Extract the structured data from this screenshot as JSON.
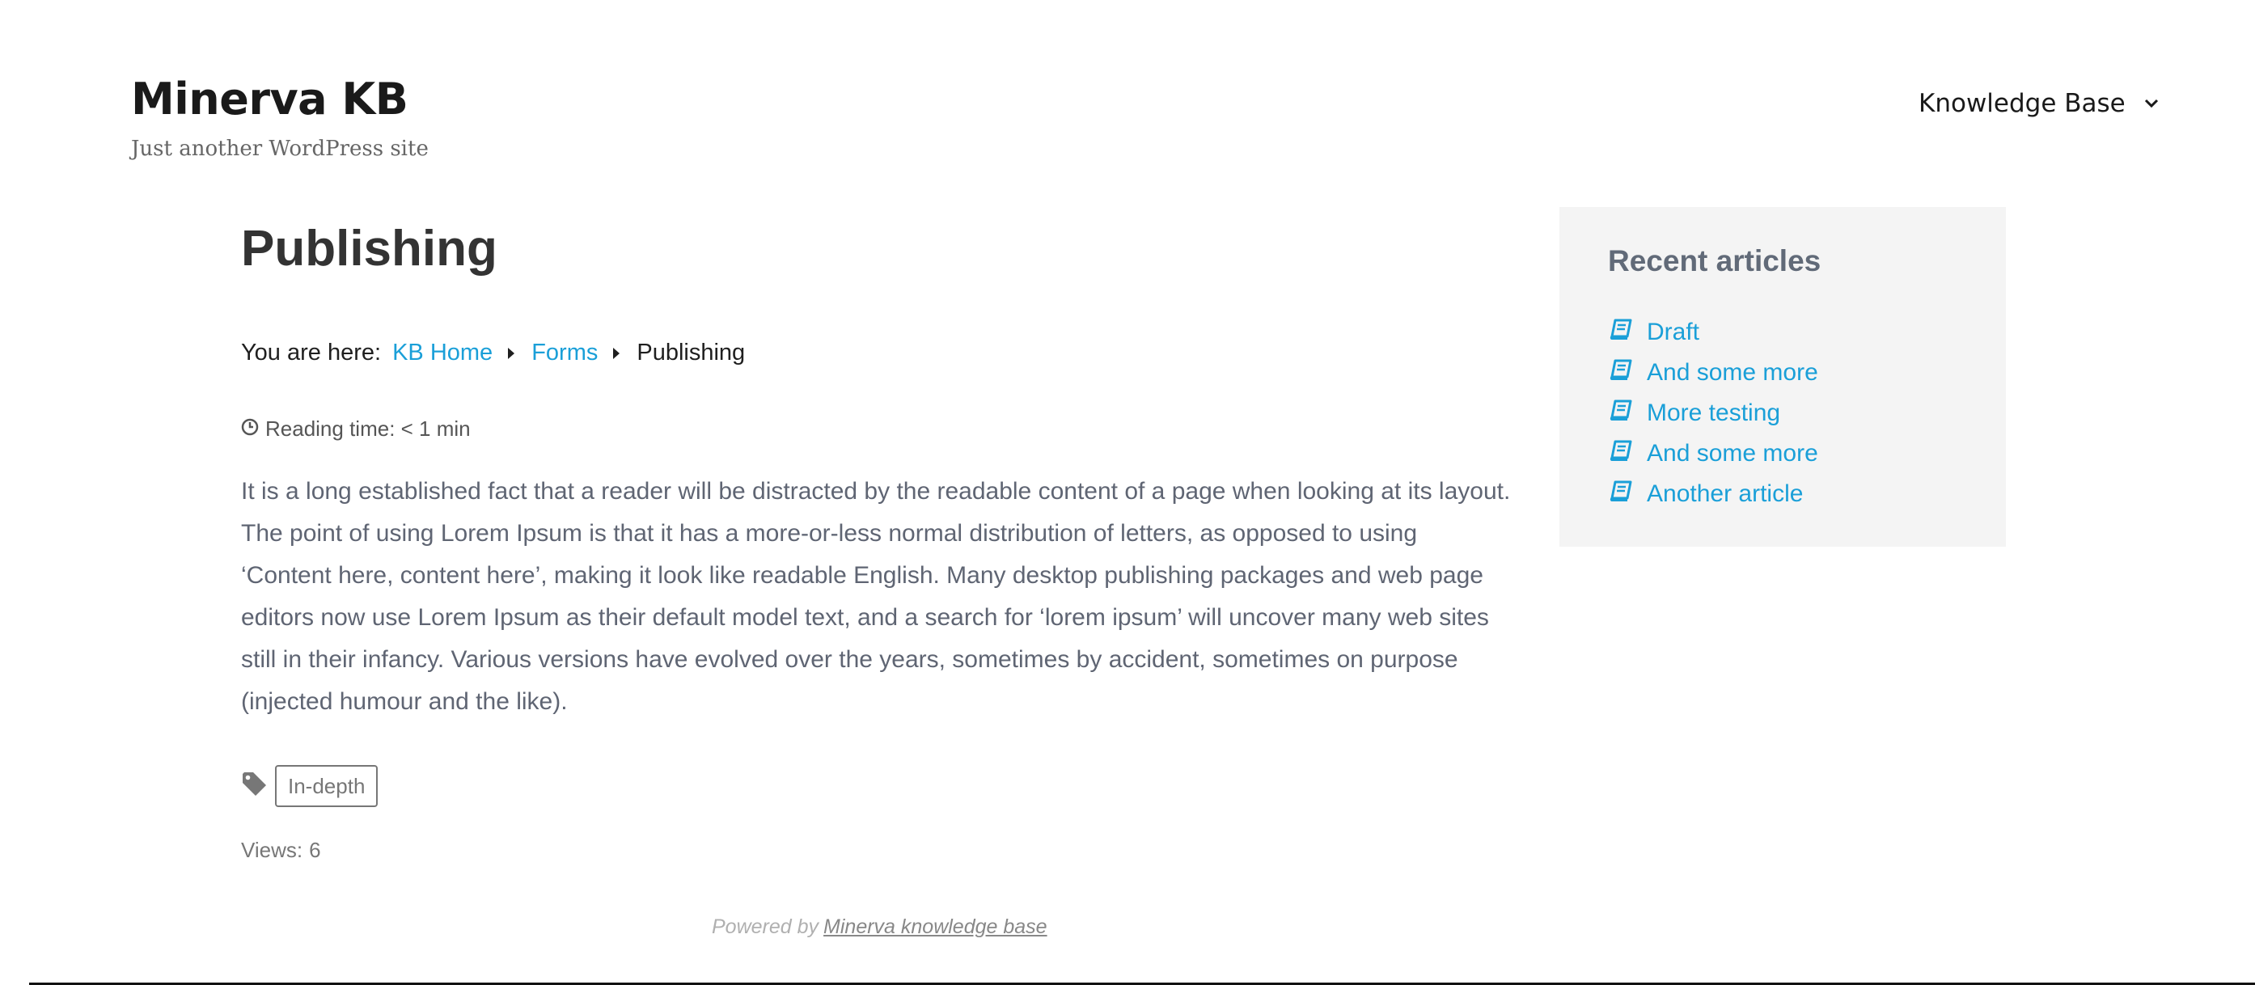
{
  "header": {
    "site_title": "Minerva KB",
    "tagline": "Just another WordPress site",
    "nav_label": "Knowledge Base"
  },
  "article": {
    "title": "Publishing",
    "breadcrumb": {
      "prefix": "You are here:",
      "items": [
        "KB Home",
        "Forms",
        "Publishing"
      ]
    },
    "reading_time": "Reading time: < 1 min",
    "body": "It is a long established fact that a reader will be distracted by the readable content of a page when looking at its layout. The point of using Lorem Ipsum is that it has a more-or-less normal distribution of letters, as opposed to using ‘Content here, content here’, making it look like readable English. Many desktop publishing packages and web page editors now use Lorem Ipsum as their default model text, and a search for ‘lorem ipsum’ will uncover many web sites still in their infancy. Various versions have evolved over the years, sometimes by accident, sometimes on purpose (injected humour and the like).",
    "tags": [
      "In-depth"
    ],
    "views_label": "Views:",
    "views_count": "6"
  },
  "sidebar": {
    "title": "Recent articles",
    "items": [
      "Draft",
      "And some more",
      "More testing",
      "And some more",
      "Another article"
    ]
  },
  "footer": {
    "powered_by": "Powered by",
    "powered_link": "Minerva knowledge base"
  },
  "colors": {
    "link": "#1a9fd8",
    "body_text": "#5f6573",
    "sidebar_bg": "#f4f4f4"
  },
  "icons": {
    "nav_chevron": "chevron-down-icon",
    "breadcrumb_separator": "caret-right-icon",
    "reading_time": "clock-icon",
    "tags": "tag-icon",
    "recent_item": "book-icon"
  }
}
